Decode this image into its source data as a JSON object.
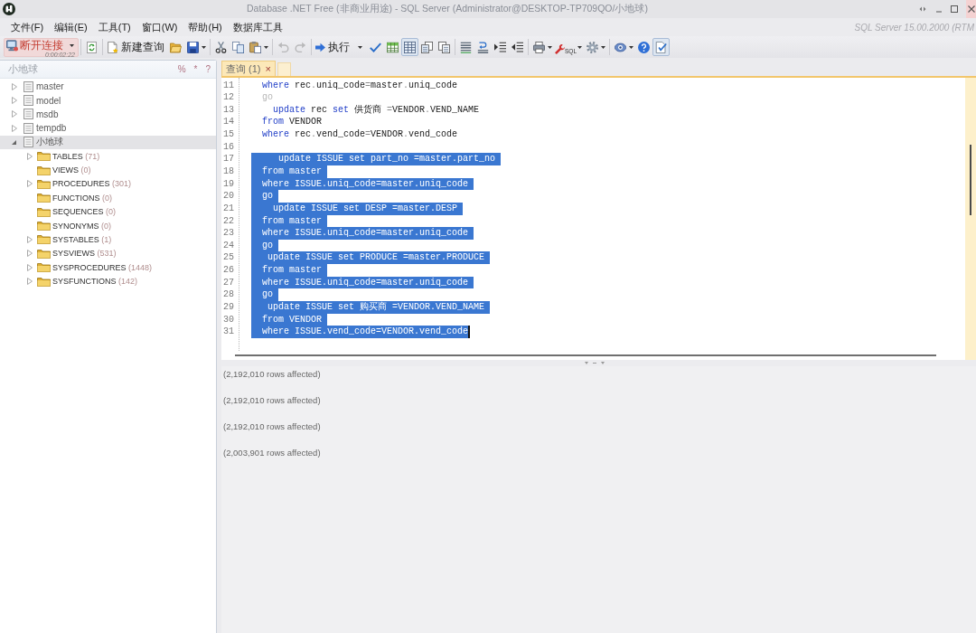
{
  "window": {
    "title": "Database .NET Free (非商业用途) - SQL Server (Administrator@DESKTOP-TP709QO/小地球)"
  },
  "menu": [
    "文件(F)",
    "编辑(E)",
    "工具(T)",
    "窗口(W)",
    "帮助(H)",
    "数据库工具"
  ],
  "server_version": "SQL Server 15.00.2000 (RTM",
  "toolbar": {
    "disconnect": {
      "label": "断开连接",
      "elapsed": "0:00:02:22"
    },
    "new_query": {
      "label": "新建查询"
    },
    "edit": [
      {
        "disabled": false
      },
      {
        "disabled": false
      },
      {
        "disabled": false
      },
      {
        "disabled": true
      },
      {
        "disabled": true
      }
    ],
    "execute": {
      "label": "执行"
    },
    "result_views": [
      {
        "pressed": false
      },
      {
        "pressed": true
      },
      {
        "pressed": false
      },
      {
        "pressed": false
      }
    ],
    "sql_tool": {
      "label": "SQL"
    },
    "extras": [
      {
        "pressed": false
      },
      {
        "pressed": false
      },
      {
        "pressed": true
      }
    ]
  },
  "explorer": {
    "title": "小地球",
    "header_buttons": [
      "%",
      "*",
      "?"
    ],
    "databases": [
      {
        "name": "master",
        "expandable": true,
        "expanded": false,
        "selected": false
      },
      {
        "name": "model",
        "expandable": true,
        "expanded": false,
        "selected": false
      },
      {
        "name": "msdb",
        "expandable": true,
        "expanded": false,
        "selected": false
      },
      {
        "name": "tempdb",
        "expandable": true,
        "expanded": false,
        "selected": false
      },
      {
        "name": "小地球",
        "expandable": true,
        "expanded": true,
        "selected": true,
        "children": [
          {
            "name": "TABLES",
            "count": "(71)",
            "expandable": true,
            "expanded": false,
            "selected": false
          },
          {
            "name": "VIEWS",
            "count": "(0)",
            "expandable": false,
            "expanded": false,
            "selected": false
          },
          {
            "name": "PROCEDURES",
            "count": "(301)",
            "expandable": true,
            "expanded": false,
            "selected": false
          },
          {
            "name": "FUNCTIONS",
            "count": "(0)",
            "expandable": false,
            "expanded": false,
            "selected": false
          },
          {
            "name": "SEQUENCES",
            "count": "(0)",
            "expandable": false,
            "expanded": false,
            "selected": false
          },
          {
            "name": "SYNONYMS",
            "count": "(0)",
            "expandable": false,
            "expanded": false,
            "selected": false
          },
          {
            "name": "SYSTABLES",
            "count": "(1)",
            "expandable": true,
            "expanded": false,
            "selected": false
          },
          {
            "name": "SYSVIEWS",
            "count": "(531)",
            "expandable": true,
            "expanded": false,
            "selected": false
          },
          {
            "name": "SYSPROCEDURES",
            "count": "(1448)",
            "expandable": true,
            "expanded": false,
            "selected": false
          },
          {
            "name": "SYSFUNCTIONS",
            "count": "(142)",
            "expandable": true,
            "expanded": false,
            "selected": false
          }
        ]
      }
    ]
  },
  "tabs": [
    {
      "label": "查询 (1)",
      "close": "×",
      "selected": true
    }
  ],
  "editor": {
    "lines": [
      {
        "number": "11",
        "selected": false,
        "tokens": [
          {
            "text": "where",
            "kind": "keyword"
          },
          {
            "text": " rec",
            "kind": "plain"
          },
          {
            "text": ".",
            "kind": "punct"
          },
          {
            "text": "uniq_code",
            "kind": "plain"
          },
          {
            "text": "=",
            "kind": "punct"
          },
          {
            "text": "master",
            "kind": "plain"
          },
          {
            "text": ".",
            "kind": "punct"
          },
          {
            "text": "uniq_code",
            "kind": "plain"
          }
        ]
      },
      {
        "number": "12",
        "selected": false,
        "tokens": [
          {
            "text": "go",
            "kind": "muted"
          }
        ]
      },
      {
        "number": "13",
        "selected": false,
        "tokens": [
          {
            "text": "  update",
            "kind": "keyword"
          },
          {
            "text": " rec ",
            "kind": "plain"
          },
          {
            "text": "set",
            "kind": "keyword"
          },
          {
            "text": " 供货商 ",
            "kind": "plain"
          },
          {
            "text": "=",
            "kind": "punct"
          },
          {
            "text": "VENDOR",
            "kind": "plain"
          },
          {
            "text": ".",
            "kind": "punct"
          },
          {
            "text": "VEND_NAME",
            "kind": "plain"
          }
        ]
      },
      {
        "number": "14",
        "selected": false,
        "tokens": [
          {
            "text": "from",
            "kind": "keyword"
          },
          {
            "text": " VENDOR",
            "kind": "plain"
          }
        ]
      },
      {
        "number": "15",
        "selected": false,
        "tokens": [
          {
            "text": "where",
            "kind": "keyword"
          },
          {
            "text": " rec",
            "kind": "plain"
          },
          {
            "text": ".",
            "kind": "punct"
          },
          {
            "text": "vend_code",
            "kind": "plain"
          },
          {
            "text": "=",
            "kind": "punct"
          },
          {
            "text": "VENDOR",
            "kind": "plain"
          },
          {
            "text": ".",
            "kind": "punct"
          },
          {
            "text": "vend_code",
            "kind": "plain"
          }
        ]
      },
      {
        "number": "16",
        "selected": false
      },
      {
        "number": "17",
        "selected": true,
        "text": "   update ISSUE set part_no =master.part_no"
      },
      {
        "number": "18",
        "selected": true,
        "text": "from master"
      },
      {
        "number": "19",
        "selected": true,
        "text": "where ISSUE.uniq_code=master.uniq_code"
      },
      {
        "number": "20",
        "selected": true,
        "text": "go"
      },
      {
        "number": "21",
        "selected": true,
        "text": "  update ISSUE set DESP =master.DESP"
      },
      {
        "number": "22",
        "selected": true,
        "text": "from master"
      },
      {
        "number": "23",
        "selected": true,
        "text": "where ISSUE.uniq_code=master.uniq_code"
      },
      {
        "number": "24",
        "selected": true,
        "text": "go"
      },
      {
        "number": "25",
        "selected": true,
        "text": " update ISSUE set PRODUCE =master.PRODUCE"
      },
      {
        "number": "26",
        "selected": true,
        "text": "from master"
      },
      {
        "number": "27",
        "selected": true,
        "text": "where ISSUE.uniq_code=master.uniq_code"
      },
      {
        "number": "28",
        "selected": true,
        "text": "go"
      },
      {
        "number": "29",
        "selected": true,
        "text": " update ISSUE set 购买商 =VENDOR.VEND_NAME"
      },
      {
        "number": "30",
        "selected": true,
        "text": "from VENDOR"
      },
      {
        "number": "31",
        "selected": true,
        "text": "where ISSUE.vend_code=VENDOR.vend_code"
      }
    ],
    "caret_at_end": true
  },
  "messages": [
    "(2,192,010 rows affected)",
    "(2,192,010 rows affected)",
    "(2,192,010 rows affected)",
    "(2,003,901 rows affected)"
  ]
}
